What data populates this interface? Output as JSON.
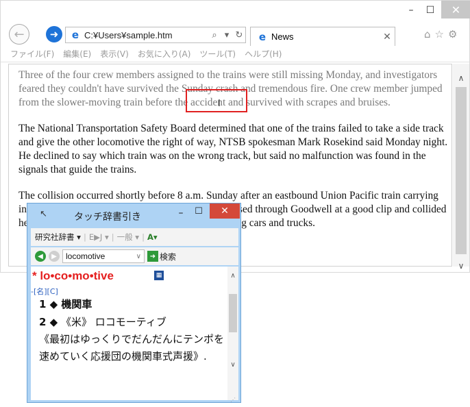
{
  "browser": {
    "address": "C:¥Users¥sample.htm",
    "tab_title": "News",
    "menu": [
      "ファイル(F)",
      "編集(E)",
      "表示(V)",
      "お気に入り(A)",
      "ツール(T)",
      "ヘルプ(H)"
    ],
    "article": {
      "para1": "Three of the four crew members assigned to the trains were still missing Monday, and investigators feared they couldn't have survived the Sunday crash and tremendous fire. One crew member jumped from the slower-moving train before the accident and survived with scrapes and bruises.",
      "para2": "The National Transportation Safety Board determined that one of the trains failed to take a side track and give the other locomotive the right of way, NTSB spokesman Mark Rosekind said Monday night. He declined to say which train was on the wrong track, but said no malfunction was found in the signals that guide the trains.",
      "para3": "The collision occurred shortly before 8 a.m. Sunday after an eastbound Union Pacific train carrying intermodal freight from Los Angeles to Chicago passed through Goodwell at a good clip and collided head-on with a westbound Union Pacific train hauling cars and trucks."
    }
  },
  "dictionary": {
    "title": "タッチ辞書引き",
    "toolbar": {
      "dict_name": "研究社辞書",
      "direction": "E▶J",
      "match": "一般",
      "format": "A"
    },
    "search": {
      "query": "locomotive",
      "button": "検索"
    },
    "entry": {
      "headword": "* lo•co•mo•tive",
      "pos": "-[名][C]",
      "sense1": "1 ◆ 機関車",
      "sense2_num": "2 ◆",
      "sense2_text": "《米》 ロコモーティブ",
      "definition": "《最初はゆっくりでだんだんにテンポを速めていく応援団の機関車式声援》."
    }
  },
  "colors": {
    "accent_blue": "#1e73d8",
    "highlight_red": "#e02020",
    "headword_red": "#e52020",
    "dict_frame": "#aed3f4",
    "close_red": "#d4493a"
  }
}
